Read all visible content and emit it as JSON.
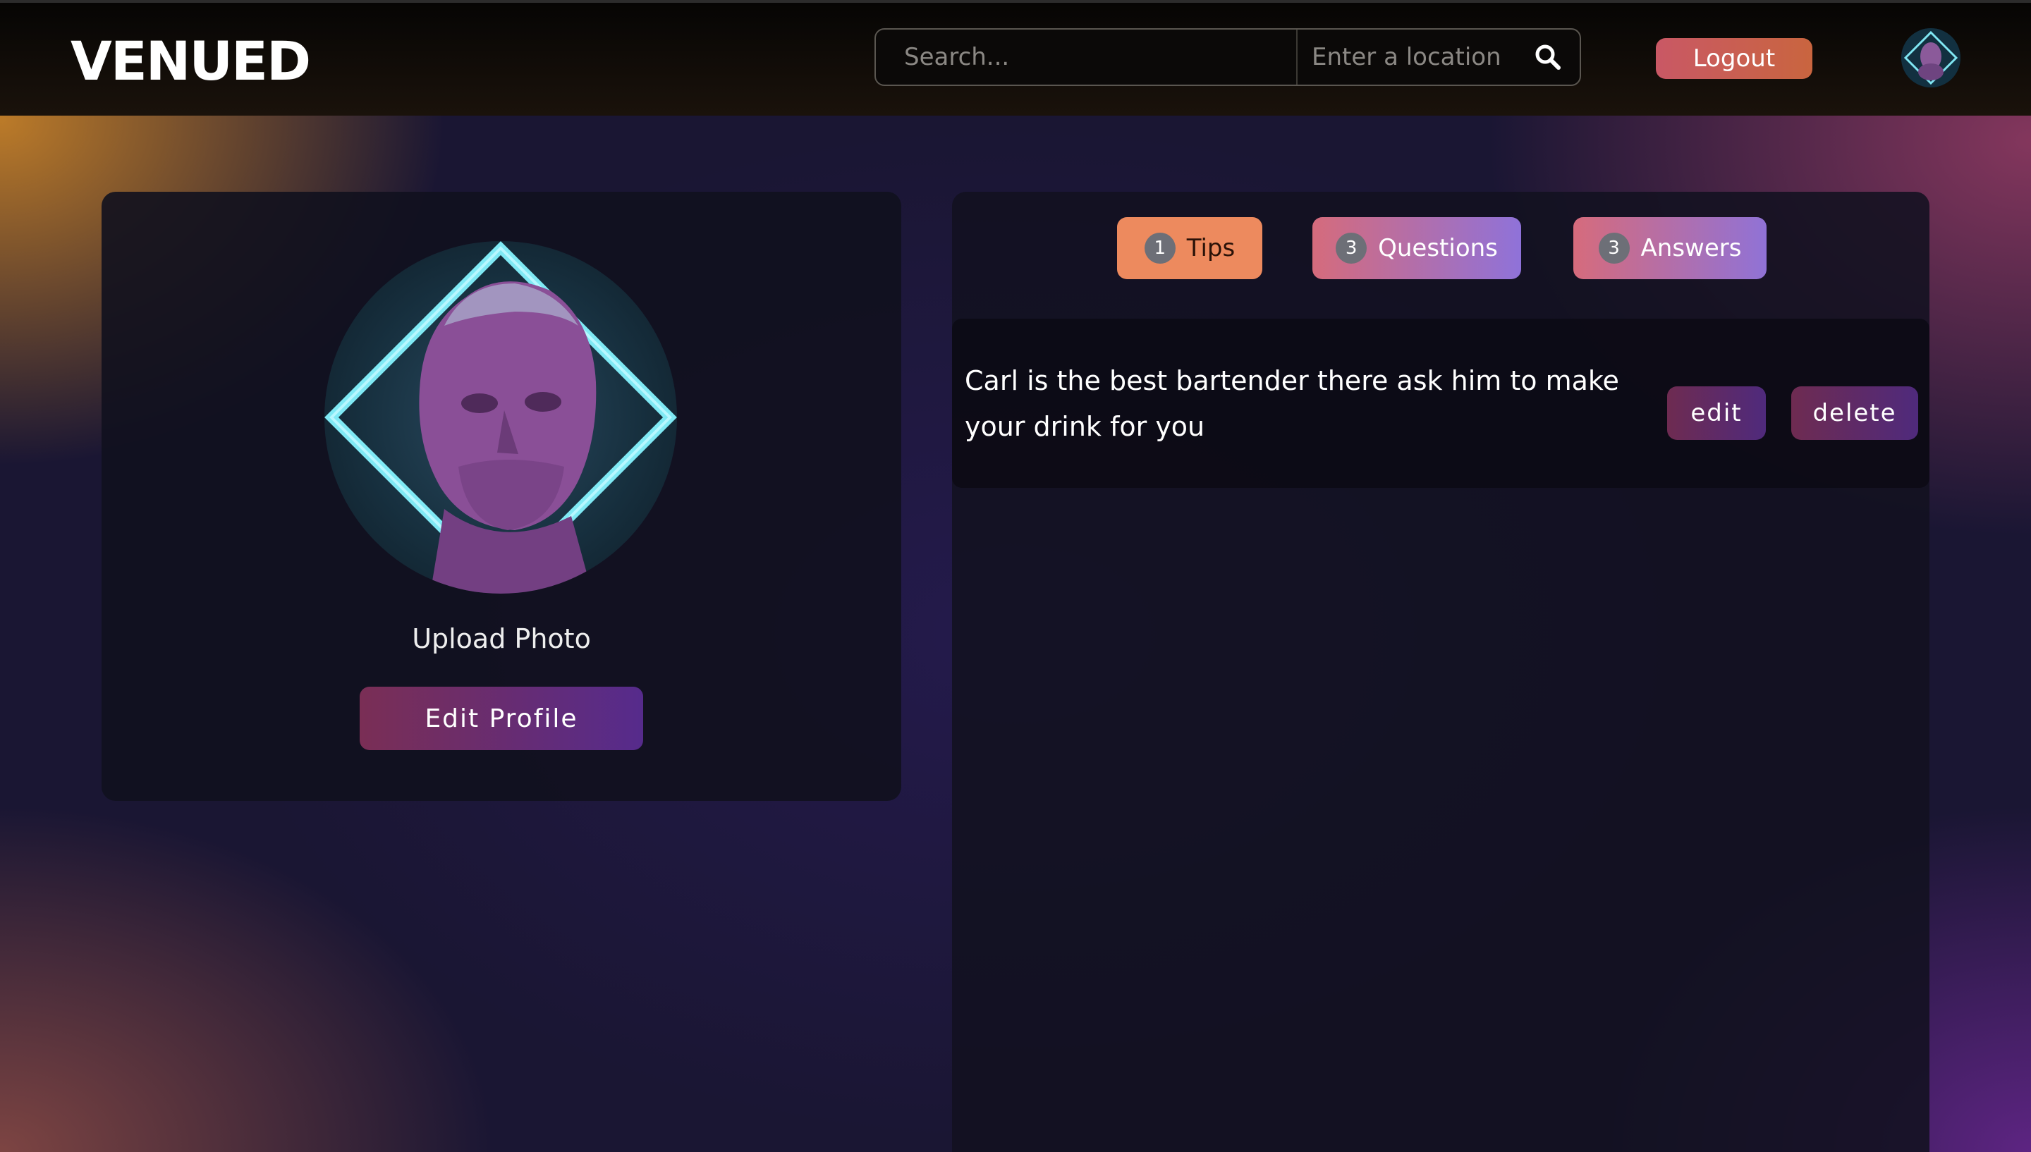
{
  "header": {
    "logo": "VENUED",
    "search_placeholder": "Search...",
    "location_placeholder": "Enter a location",
    "search_icon": "search-icon",
    "logout_label": "Logout",
    "avatar_icon": "user-avatar"
  },
  "profile": {
    "upload_label": "Upload Photo",
    "edit_label": "Edit Profile"
  },
  "tabs": [
    {
      "count": "1",
      "label": "Tips"
    },
    {
      "count": "3",
      "label": "Questions"
    },
    {
      "count": "3",
      "label": "Answers"
    }
  ],
  "tips": [
    {
      "text": "Carl is the best bartender there ask him to make your drink for you",
      "edit_label": "edit",
      "delete_label": "delete"
    }
  ],
  "colors": {
    "tips_tab": "#ed8a5e",
    "logout": "#c95865",
    "accent_purple": "#562b8c"
  }
}
